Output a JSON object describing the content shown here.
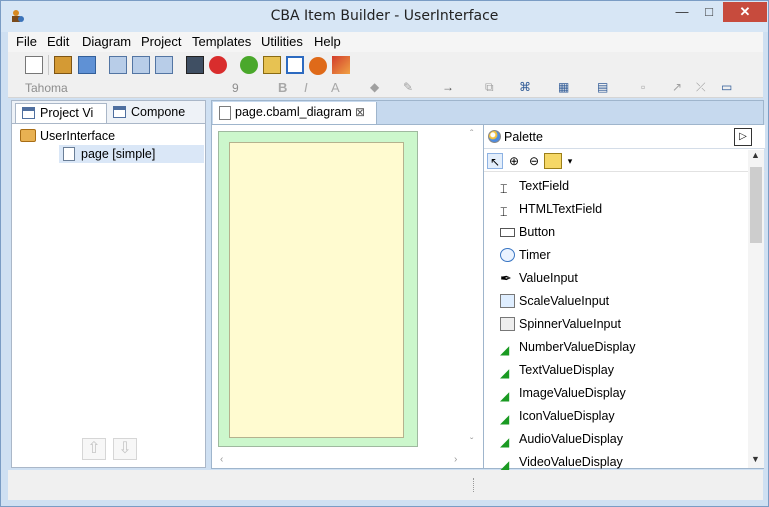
{
  "window": {
    "title": "CBA Item Builder - UserInterface",
    "minimize": "—",
    "maximize": "□",
    "close": "✕"
  },
  "menu": [
    "File",
    "Edit",
    "Diagram",
    "Project",
    "Templates",
    "Utilities",
    "Help"
  ],
  "format_toolbar": {
    "font": "Tahoma",
    "size": "9",
    "bold": "B",
    "italic": "I",
    "font_color": "A"
  },
  "left_tabs": [
    "Project Vi",
    "Compone"
  ],
  "tree": {
    "root": "UserInterface",
    "child": "page [simple]"
  },
  "editor_tab": {
    "label": "page.cbaml_diagram",
    "close": "⊠"
  },
  "palette": {
    "title": "Palette",
    "items": [
      "TextField",
      "HTMLTextField",
      "Button",
      "Timer",
      "ValueInput",
      "ScaleValueInput",
      "SpinnerValueInput",
      "NumberValueDisplay",
      "TextValueDisplay",
      "ImageValueDisplay",
      "IconValueDisplay",
      "AudioValueDisplay",
      "VideoValueDisplay"
    ]
  },
  "colors": {
    "canvas_outer": "#ccf7cc",
    "canvas_inner": "#fffbd0",
    "close_button": "#c74b3d"
  },
  "icons": [
    "app-logo-icon",
    "pointer-icon",
    "zoom-in-icon",
    "zoom-out-icon",
    "folder-icon",
    "page-icon",
    "palette-icon"
  ]
}
